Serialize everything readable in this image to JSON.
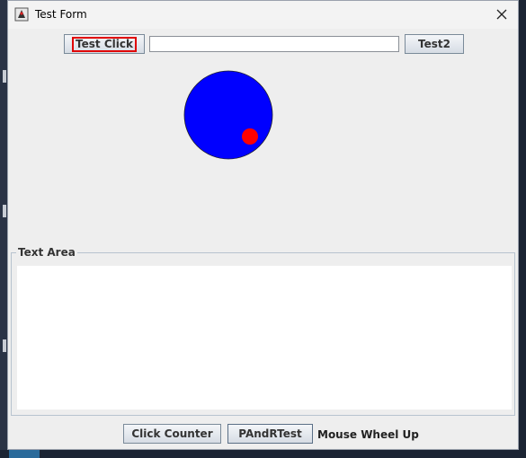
{
  "window": {
    "title": "Test Form",
    "app_icon": "java-duke-icon",
    "close_icon": "close-icon"
  },
  "toolbar": {
    "test_click_label": "Test Click",
    "text_field_value": "",
    "test2_label": "Test2"
  },
  "canvas": {
    "big_circle_color": "#0000ff",
    "small_circle_color": "#ff0000"
  },
  "text_area": {
    "group_title": "Text Area",
    "value": ""
  },
  "footer": {
    "click_counter_label": "Click Counter",
    "pandr_label": "PAndRTest",
    "mouse_wheel_label": "Mouse Wheel Up"
  }
}
